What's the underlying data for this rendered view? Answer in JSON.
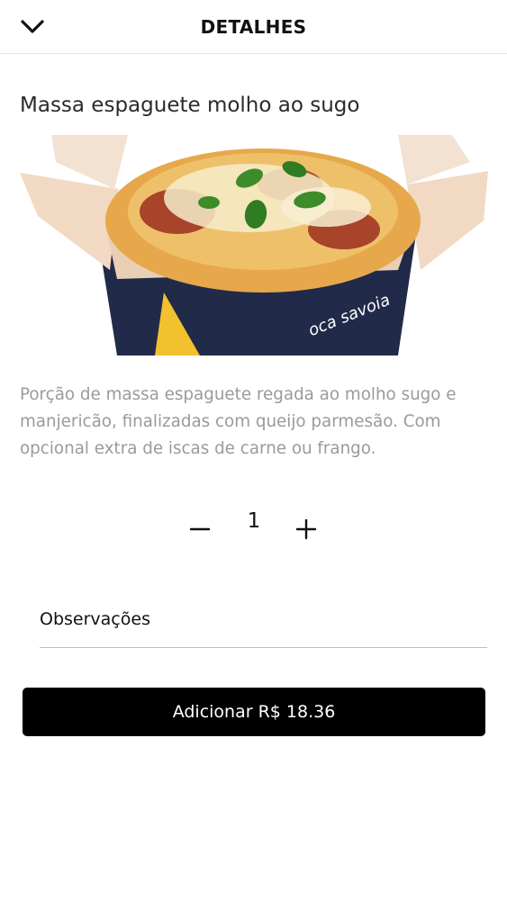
{
  "header": {
    "title": "DETALHES",
    "back_icon": "chevron-down-icon"
  },
  "product": {
    "name": "Massa espaguete molho ao sugo",
    "image_brand_text": "oca savoia",
    "description": "Porção de massa espaguete regada ao molho sugo e manjericão, finalizadas com queijo parmesão. Com opcional extra de iscas de carne ou frango."
  },
  "quantity": {
    "value": "1",
    "minus_icon": "minus-icon",
    "plus_icon": "plus-icon"
  },
  "notes": {
    "placeholder": "Observações",
    "value": ""
  },
  "cta": {
    "label": "Adicionar R$ 18.36"
  },
  "colors": {
    "primary_button": "#000000",
    "text_muted": "#9a9a9a",
    "divider": "#e6e6e6"
  }
}
